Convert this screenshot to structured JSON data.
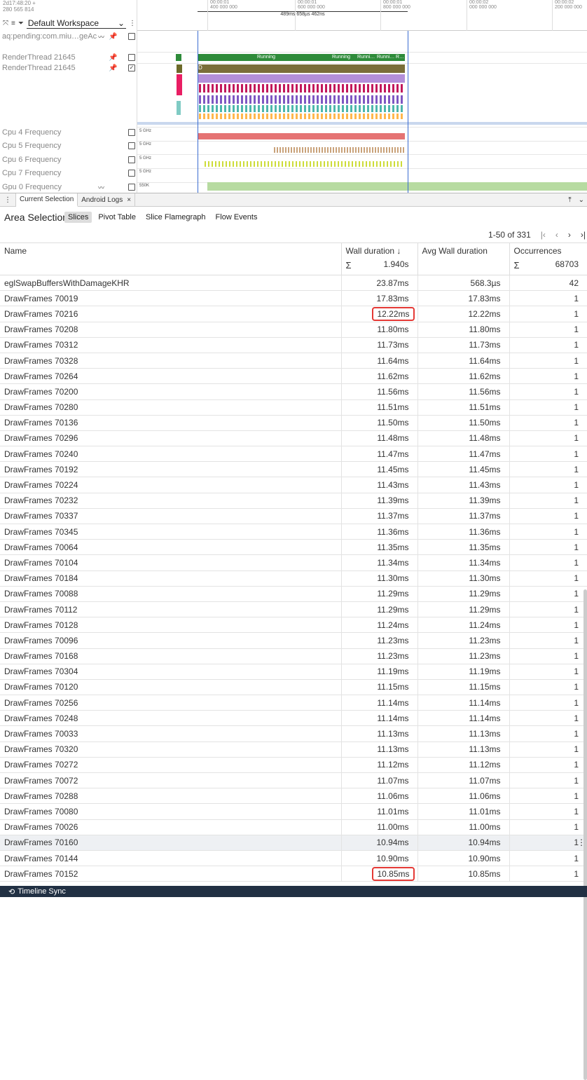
{
  "timeline": {
    "timestamp_line1": "2d17:48:20 +",
    "timestamp_line2": "280 565 814",
    "workspace": "Default Workspace",
    "ticks": [
      {
        "top": "00:00:01",
        "bottom": "400 000 000"
      },
      {
        "top": "00:00:01",
        "bottom": "600 000 000"
      },
      {
        "top": "00:00:01",
        "bottom": "800 000 000"
      },
      {
        "top": "00:00:02",
        "bottom": "000 000 000"
      },
      {
        "top": "00:00:02",
        "bottom": "200 000 000"
      }
    ],
    "span_label": "489ms 658µs 462ns",
    "tracks": [
      {
        "name": "aq:pending:com.miu…geActivity",
        "checked": false
      },
      {
        "name": "RenderThread 21645",
        "checked": false
      },
      {
        "name": "RenderThread 21645",
        "checked": true
      },
      {
        "name": "Cpu 4 Frequency",
        "checked": false,
        "scale": "5 GHz"
      },
      {
        "name": "Cpu 5 Frequency",
        "checked": false,
        "scale": "5 GHz"
      },
      {
        "name": "Cpu 6 Frequency",
        "checked": false,
        "scale": "5 GHz"
      },
      {
        "name": "Cpu 7 Frequency",
        "checked": false,
        "scale": "5 GHz"
      },
      {
        "name": "Gpu 0 Frequency",
        "checked": false,
        "scale": "550K"
      }
    ],
    "running_labels": [
      "Running",
      "Running",
      "Runni…",
      "Runni…",
      "R…"
    ],
    "slice_letter": "D"
  },
  "tabs": [
    {
      "label": "Current Selection",
      "active": true
    },
    {
      "label": "Android Logs",
      "active": false,
      "close": "×"
    }
  ],
  "panel": {
    "title": "Area Selection",
    "subtabs": [
      "Slices",
      "Pivot Table",
      "Slice Flamegraph",
      "Flow Events"
    ],
    "pager": "1-50 of 331",
    "columns": {
      "name": "Name",
      "wall": "Wall duration ↓",
      "avg": "Avg Wall duration",
      "occ": "Occurrences",
      "sigma": "Σ",
      "wall_total": "1.940s",
      "occ_total": "68703"
    },
    "rows": [
      {
        "name": "eglSwapBuffersWithDamageKHR",
        "wall": "23.87ms",
        "avg": "568.3µs",
        "occ": "42"
      },
      {
        "name": "DrawFrames 70019",
        "wall": "17.83ms",
        "avg": "17.83ms",
        "occ": "1"
      },
      {
        "name": "DrawFrames 70216",
        "wall": "12.22ms",
        "avg": "12.22ms",
        "occ": "1",
        "boxed": true
      },
      {
        "name": "DrawFrames 70208",
        "wall": "11.80ms",
        "avg": "11.80ms",
        "occ": "1"
      },
      {
        "name": "DrawFrames 70312",
        "wall": "11.73ms",
        "avg": "11.73ms",
        "occ": "1"
      },
      {
        "name": "DrawFrames 70328",
        "wall": "11.64ms",
        "avg": "11.64ms",
        "occ": "1"
      },
      {
        "name": "DrawFrames 70264",
        "wall": "11.62ms",
        "avg": "11.62ms",
        "occ": "1"
      },
      {
        "name": "DrawFrames 70200",
        "wall": "11.56ms",
        "avg": "11.56ms",
        "occ": "1"
      },
      {
        "name": "DrawFrames 70280",
        "wall": "11.51ms",
        "avg": "11.51ms",
        "occ": "1"
      },
      {
        "name": "DrawFrames 70136",
        "wall": "11.50ms",
        "avg": "11.50ms",
        "occ": "1"
      },
      {
        "name": "DrawFrames 70296",
        "wall": "11.48ms",
        "avg": "11.48ms",
        "occ": "1"
      },
      {
        "name": "DrawFrames 70240",
        "wall": "11.47ms",
        "avg": "11.47ms",
        "occ": "1"
      },
      {
        "name": "DrawFrames 70192",
        "wall": "11.45ms",
        "avg": "11.45ms",
        "occ": "1"
      },
      {
        "name": "DrawFrames 70224",
        "wall": "11.43ms",
        "avg": "11.43ms",
        "occ": "1"
      },
      {
        "name": "DrawFrames 70232",
        "wall": "11.39ms",
        "avg": "11.39ms",
        "occ": "1"
      },
      {
        "name": "DrawFrames 70337",
        "wall": "11.37ms",
        "avg": "11.37ms",
        "occ": "1"
      },
      {
        "name": "DrawFrames 70345",
        "wall": "11.36ms",
        "avg": "11.36ms",
        "occ": "1"
      },
      {
        "name": "DrawFrames 70064",
        "wall": "11.35ms",
        "avg": "11.35ms",
        "occ": "1"
      },
      {
        "name": "DrawFrames 70104",
        "wall": "11.34ms",
        "avg": "11.34ms",
        "occ": "1"
      },
      {
        "name": "DrawFrames 70184",
        "wall": "11.30ms",
        "avg": "11.30ms",
        "occ": "1"
      },
      {
        "name": "DrawFrames 70088",
        "wall": "11.29ms",
        "avg": "11.29ms",
        "occ": "1"
      },
      {
        "name": "DrawFrames 70112",
        "wall": "11.29ms",
        "avg": "11.29ms",
        "occ": "1"
      },
      {
        "name": "DrawFrames 70128",
        "wall": "11.24ms",
        "avg": "11.24ms",
        "occ": "1"
      },
      {
        "name": "DrawFrames 70096",
        "wall": "11.23ms",
        "avg": "11.23ms",
        "occ": "1"
      },
      {
        "name": "DrawFrames 70168",
        "wall": "11.23ms",
        "avg": "11.23ms",
        "occ": "1"
      },
      {
        "name": "DrawFrames 70304",
        "wall": "11.19ms",
        "avg": "11.19ms",
        "occ": "1"
      },
      {
        "name": "DrawFrames 70120",
        "wall": "11.15ms",
        "avg": "11.15ms",
        "occ": "1"
      },
      {
        "name": "DrawFrames 70256",
        "wall": "11.14ms",
        "avg": "11.14ms",
        "occ": "1"
      },
      {
        "name": "DrawFrames 70248",
        "wall": "11.14ms",
        "avg": "11.14ms",
        "occ": "1"
      },
      {
        "name": "DrawFrames 70033",
        "wall": "11.13ms",
        "avg": "11.13ms",
        "occ": "1"
      },
      {
        "name": "DrawFrames 70320",
        "wall": "11.13ms",
        "avg": "11.13ms",
        "occ": "1"
      },
      {
        "name": "DrawFrames 70272",
        "wall": "11.12ms",
        "avg": "11.12ms",
        "occ": "1"
      },
      {
        "name": "DrawFrames 70072",
        "wall": "11.07ms",
        "avg": "11.07ms",
        "occ": "1"
      },
      {
        "name": "DrawFrames 70288",
        "wall": "11.06ms",
        "avg": "11.06ms",
        "occ": "1"
      },
      {
        "name": "DrawFrames 70080",
        "wall": "11.01ms",
        "avg": "11.01ms",
        "occ": "1"
      },
      {
        "name": "DrawFrames 70026",
        "wall": "11.00ms",
        "avg": "11.00ms",
        "occ": "1"
      },
      {
        "name": "DrawFrames 70160",
        "wall": "10.94ms",
        "avg": "10.94ms",
        "occ": "1",
        "hover": true
      },
      {
        "name": "DrawFrames 70144",
        "wall": "10.90ms",
        "avg": "10.90ms",
        "occ": "1"
      },
      {
        "name": "DrawFrames 70152",
        "wall": "10.85ms",
        "avg": "10.85ms",
        "occ": "1",
        "boxed": true
      }
    ]
  },
  "statusbar": {
    "label": "Timeline Sync"
  },
  "colors": {
    "accent": "#e53935",
    "selection": "#3b6cd1",
    "running": "#2e8b3a",
    "statusbar": "#213043"
  }
}
